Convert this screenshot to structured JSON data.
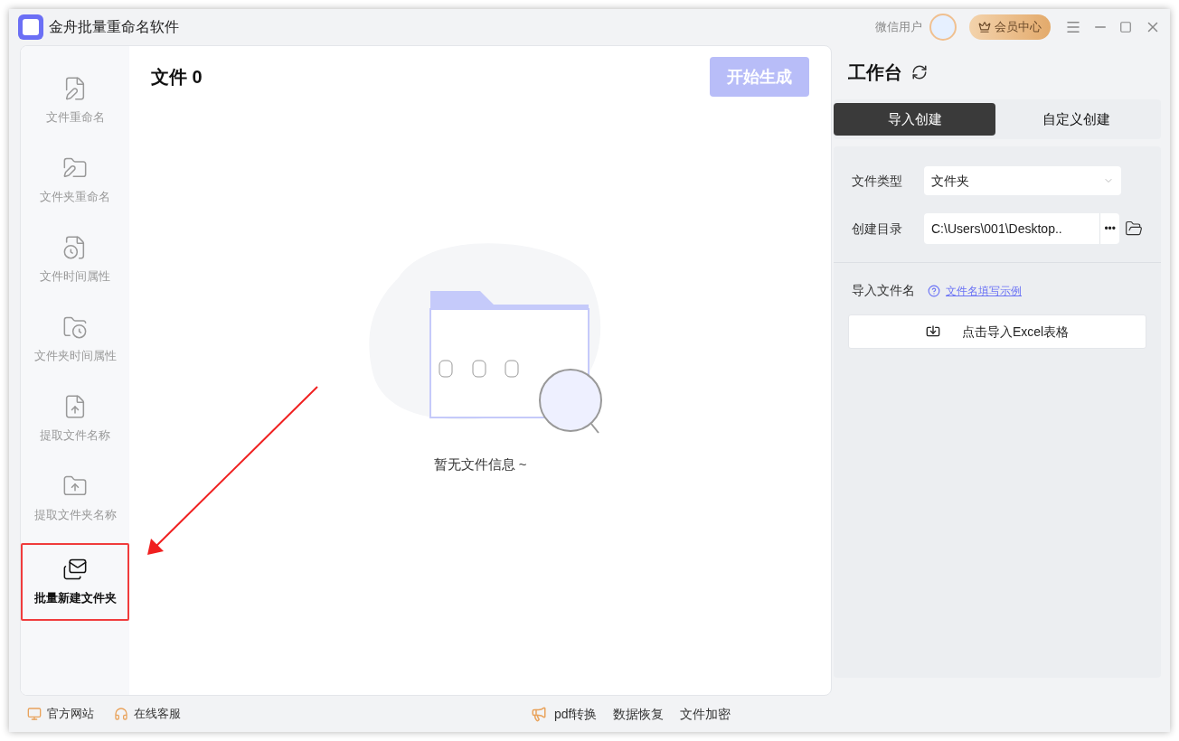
{
  "window": {
    "title": "金舟批量重命名软件",
    "user": "微信用户",
    "vip_button": "会员中心"
  },
  "sidebar": {
    "items": [
      {
        "label": "文件重命名",
        "selected": false
      },
      {
        "label": "文件夹重命名",
        "selected": false
      },
      {
        "label": "文件时间属性",
        "selected": false
      },
      {
        "label": "文件夹时间属性",
        "selected": false
      },
      {
        "label": "提取文件名称",
        "selected": false
      },
      {
        "label": "提取文件夹名称",
        "selected": false
      },
      {
        "label": "批量新建文件夹",
        "selected": true
      }
    ]
  },
  "main": {
    "title": "文件 0",
    "start_button": "开始生成",
    "start_disabled": true,
    "empty_text": "暂无文件信息 ~"
  },
  "workbench": {
    "title": "工作台",
    "tabs": [
      {
        "label": "导入创建",
        "selected": true
      },
      {
        "label": "自定义创建",
        "selected": false
      }
    ],
    "file_type": {
      "label": "文件类型",
      "value": "文件夹"
    },
    "directory": {
      "label": "创建目录",
      "value": "C:\\Users\\001\\Desktop..",
      "more": "•••"
    },
    "import_label": "导入文件名",
    "example_link": "文件名填写示例",
    "import_button": "点击导入Excel表格"
  },
  "status_bar": {
    "left": [
      "官方网站",
      "在线客服"
    ],
    "center": [
      "pdf转换",
      "数据恢复",
      "文件加密"
    ]
  }
}
